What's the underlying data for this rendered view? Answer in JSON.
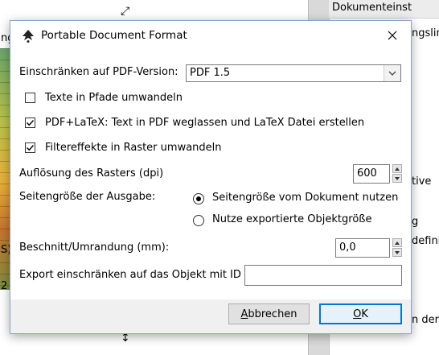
{
  "background": {
    "canvas_fragments": [
      "ng",
      "S)",
      "2"
    ],
    "panel": {
      "header": "Dokumenteinst",
      "lines": [
        "ngslin",
        "tive",
        "g",
        "definit",
        "n der"
      ]
    }
  },
  "dialog": {
    "title": "Portable Document Format",
    "pdf_version": {
      "label": "Einschränken auf PDF-Version:",
      "selected": "PDF 1.5"
    },
    "text_to_path": {
      "label": "Texte in Pfade umwandeln",
      "checked": false
    },
    "pdf_latex": {
      "label": "PDF+LaTeX: Text in PDF weglassen und LaTeX Datei erstellen",
      "checked": true
    },
    "rasterize_filters": {
      "label": "Filtereffekte in Raster umwandeln",
      "checked": true
    },
    "raster_resolution": {
      "label": "Auflösung des Rasters (dpi)",
      "value": "600"
    },
    "page_size": {
      "label": "Seitengröße der Ausgabe:",
      "options": [
        {
          "label": "Seitengröße vom Dokument nutzen",
          "selected": true
        },
        {
          "label": "Nutze exportierte Objektgröße",
          "selected": false
        }
      ]
    },
    "bleed": {
      "label": "Beschnitt/Umrandung (mm):",
      "value": "0,0"
    },
    "export_id": {
      "label": "Export einschränken auf das Objekt mit ID",
      "value": ""
    },
    "buttons": {
      "cancel": {
        "label_underlined": "A",
        "label_rest": "bbrechen"
      },
      "ok": {
        "label_underlined": "O",
        "label_rest": "K"
      }
    }
  },
  "colors": {
    "accent": "#0078d7",
    "dialog_border": "#8aa5c4"
  }
}
